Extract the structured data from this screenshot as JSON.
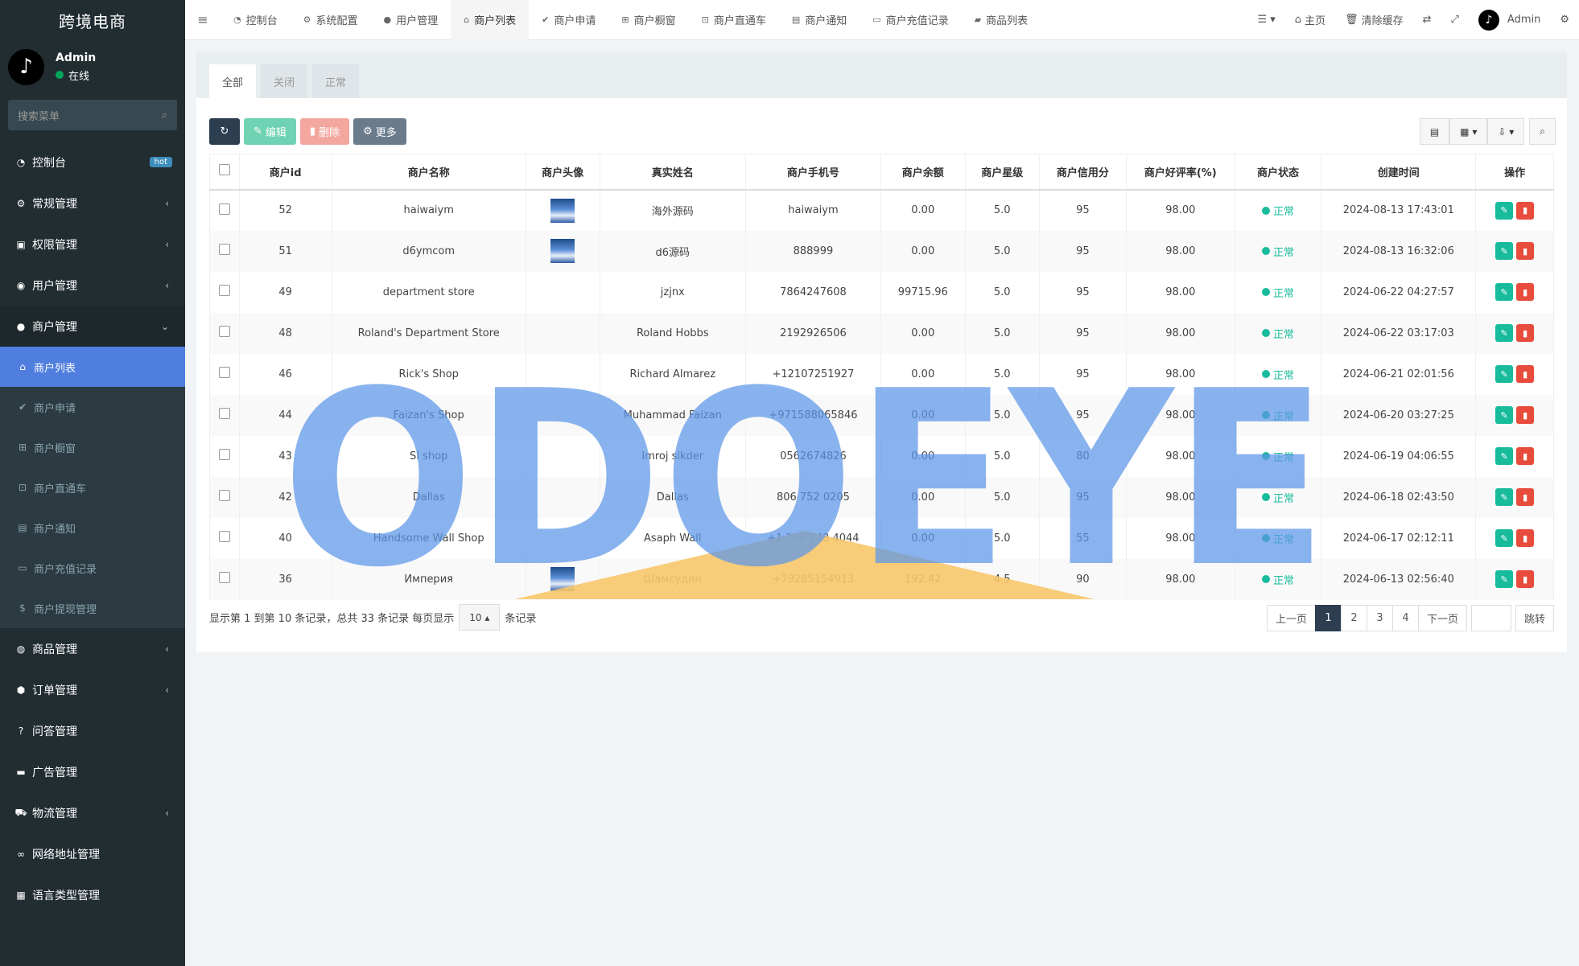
{
  "brand": "跨境电商",
  "user": {
    "name": "Admin",
    "status": "在线"
  },
  "sidebar": {
    "search_placeholder": "搜索菜单",
    "items": [
      {
        "label": "控制台",
        "icon": "dashboard-icon",
        "badge": "hot"
      },
      {
        "label": "常规管理",
        "icon": "cogs-icon"
      },
      {
        "label": "权限管理",
        "icon": "group-icon"
      },
      {
        "label": "用户管理",
        "icon": "user-circle-icon"
      },
      {
        "label": "商户管理",
        "icon": "apple-icon"
      },
      {
        "label": "商品管理",
        "icon": "product-icon"
      },
      {
        "label": "订单管理",
        "icon": "order-icon"
      },
      {
        "label": "问答管理",
        "icon": "question-icon"
      },
      {
        "label": "广告管理",
        "icon": "ad-icon"
      },
      {
        "label": "物流管理",
        "icon": "truck-icon"
      },
      {
        "label": "网络地址管理",
        "icon": "link-icon"
      },
      {
        "label": "语言类型管理",
        "icon": "language-icon"
      }
    ],
    "sub_items": [
      {
        "label": "商户列表",
        "icon": "home-icon"
      },
      {
        "label": "商户申请",
        "icon": "check-circle-icon"
      },
      {
        "label": "商户橱窗",
        "icon": "cart-icon"
      },
      {
        "label": "商户直通车",
        "icon": "car-icon"
      },
      {
        "label": "商户通知",
        "icon": "notice-icon"
      },
      {
        "label": "商户充值记录",
        "icon": "money-icon"
      },
      {
        "label": "商户提现管理",
        "icon": "dollar-icon"
      }
    ]
  },
  "topbar": {
    "tabs": [
      {
        "label": "控制台",
        "icon": "dashboard-icon"
      },
      {
        "label": "系统配置",
        "icon": "gear-icon"
      },
      {
        "label": "用户管理",
        "icon": "user-icon"
      },
      {
        "label": "商户列表",
        "icon": "home-icon"
      },
      {
        "label": "商户申请",
        "icon": "check-circle-icon"
      },
      {
        "label": "商户橱窗",
        "icon": "cart-icon"
      },
      {
        "label": "商户直通车",
        "icon": "car-icon"
      },
      {
        "label": "商户通知",
        "icon": "notice-icon"
      },
      {
        "label": "商户充值记录",
        "icon": "money-icon"
      },
      {
        "label": "商品列表",
        "icon": "bag-icon"
      }
    ],
    "home": "主页",
    "clear_cache": "清除缓存",
    "admin": "Admin"
  },
  "filter_tabs": [
    "全部",
    "关闭",
    "正常"
  ],
  "toolbar": {
    "edit": "编辑",
    "delete": "删除",
    "more": "更多"
  },
  "table": {
    "columns": [
      "商户id",
      "商户名称",
      "商户头像",
      "真实姓名",
      "商户手机号",
      "商户余额",
      "商户星级",
      "商户信用分",
      "商户好评率(%)",
      "商户状态",
      "创建时间",
      "操作"
    ],
    "rows": [
      {
        "id": "52",
        "name": "haiwaiym",
        "avatar": true,
        "real_name": "海外源码",
        "phone": "haiwaiym",
        "balance": "0.00",
        "star": "5.0",
        "credit": "95",
        "rate": "98.00",
        "status": "正常",
        "created": "2024-08-13 17:43:01"
      },
      {
        "id": "51",
        "name": "d6ymcom",
        "avatar": true,
        "real_name": "d6源码",
        "phone": "888999",
        "balance": "0.00",
        "star": "5.0",
        "credit": "95",
        "rate": "98.00",
        "status": "正常",
        "created": "2024-08-13 16:32:06"
      },
      {
        "id": "49",
        "name": "department store",
        "avatar": false,
        "real_name": "jzjnx",
        "phone": "7864247608",
        "balance": "99715.96",
        "star": "5.0",
        "credit": "95",
        "rate": "98.00",
        "status": "正常",
        "created": "2024-06-22 04:27:57"
      },
      {
        "id": "48",
        "name": "Roland's Department Store",
        "avatar": false,
        "real_name": "Roland Hobbs",
        "phone": "2192926506",
        "balance": "0.00",
        "star": "5.0",
        "credit": "95",
        "rate": "98.00",
        "status": "正常",
        "created": "2024-06-22 03:17:03"
      },
      {
        "id": "46",
        "name": "Rick's Shop",
        "avatar": false,
        "real_name": "Richard Almarez",
        "phone": "+12107251927",
        "balance": "0.00",
        "star": "5.0",
        "credit": "95",
        "rate": "98.00",
        "status": "正常",
        "created": "2024-06-21 02:01:56"
      },
      {
        "id": "44",
        "name": "Faizan's Shop",
        "avatar": false,
        "real_name": "Muhammad Faizan",
        "phone": "+971588065846",
        "balance": "0.00",
        "star": "5.0",
        "credit": "95",
        "rate": "98.00",
        "status": "正常",
        "created": "2024-06-20 03:27:25"
      },
      {
        "id": "43",
        "name": "SI shop",
        "avatar": false,
        "real_name": "Imroj sikder",
        "phone": "0562674826",
        "balance": "0.00",
        "star": "5.0",
        "credit": "80",
        "rate": "98.00",
        "status": "正常",
        "created": "2024-06-19 04:06:55"
      },
      {
        "id": "42",
        "name": "Dallas",
        "avatar": false,
        "real_name": "Dallas",
        "phone": "806 752 0205",
        "balance": "0.00",
        "star": "5.0",
        "credit": "95",
        "rate": "98.00",
        "status": "正常",
        "created": "2024-06-18 02:43:50"
      },
      {
        "id": "40",
        "name": "Handsome Wall Shop",
        "avatar": false,
        "real_name": "Asaph Wall",
        "phone": "+1 246 243 4044",
        "balance": "0.00",
        "star": "5.0",
        "credit": "55",
        "rate": "98.00",
        "status": "正常",
        "created": "2024-06-17 02:12:11"
      },
      {
        "id": "36",
        "name": "Империя",
        "avatar": true,
        "real_name": "Шамсудин",
        "phone": "+79285154913",
        "balance": "192.42",
        "star": "4.5",
        "credit": "90",
        "rate": "98.00",
        "status": "正常",
        "created": "2024-06-13 02:56:40"
      }
    ]
  },
  "footer": {
    "info_prefix": "显示第 1 到第 10 条记录，总共 33 条记录 每页显示",
    "page_size": "10",
    "info_suffix": "条记录"
  },
  "pagination": {
    "prev": "上一页",
    "pages": [
      "1",
      "2",
      "3",
      "4"
    ],
    "next": "下一页",
    "jump": "跳转"
  },
  "watermark": "ODOEYE",
  "colors": {
    "sidebar": "#222d32",
    "active": "#4f7ede",
    "success": "#18bc9c",
    "danger": "#e74c3c",
    "watermark": "#5b95e8"
  }
}
